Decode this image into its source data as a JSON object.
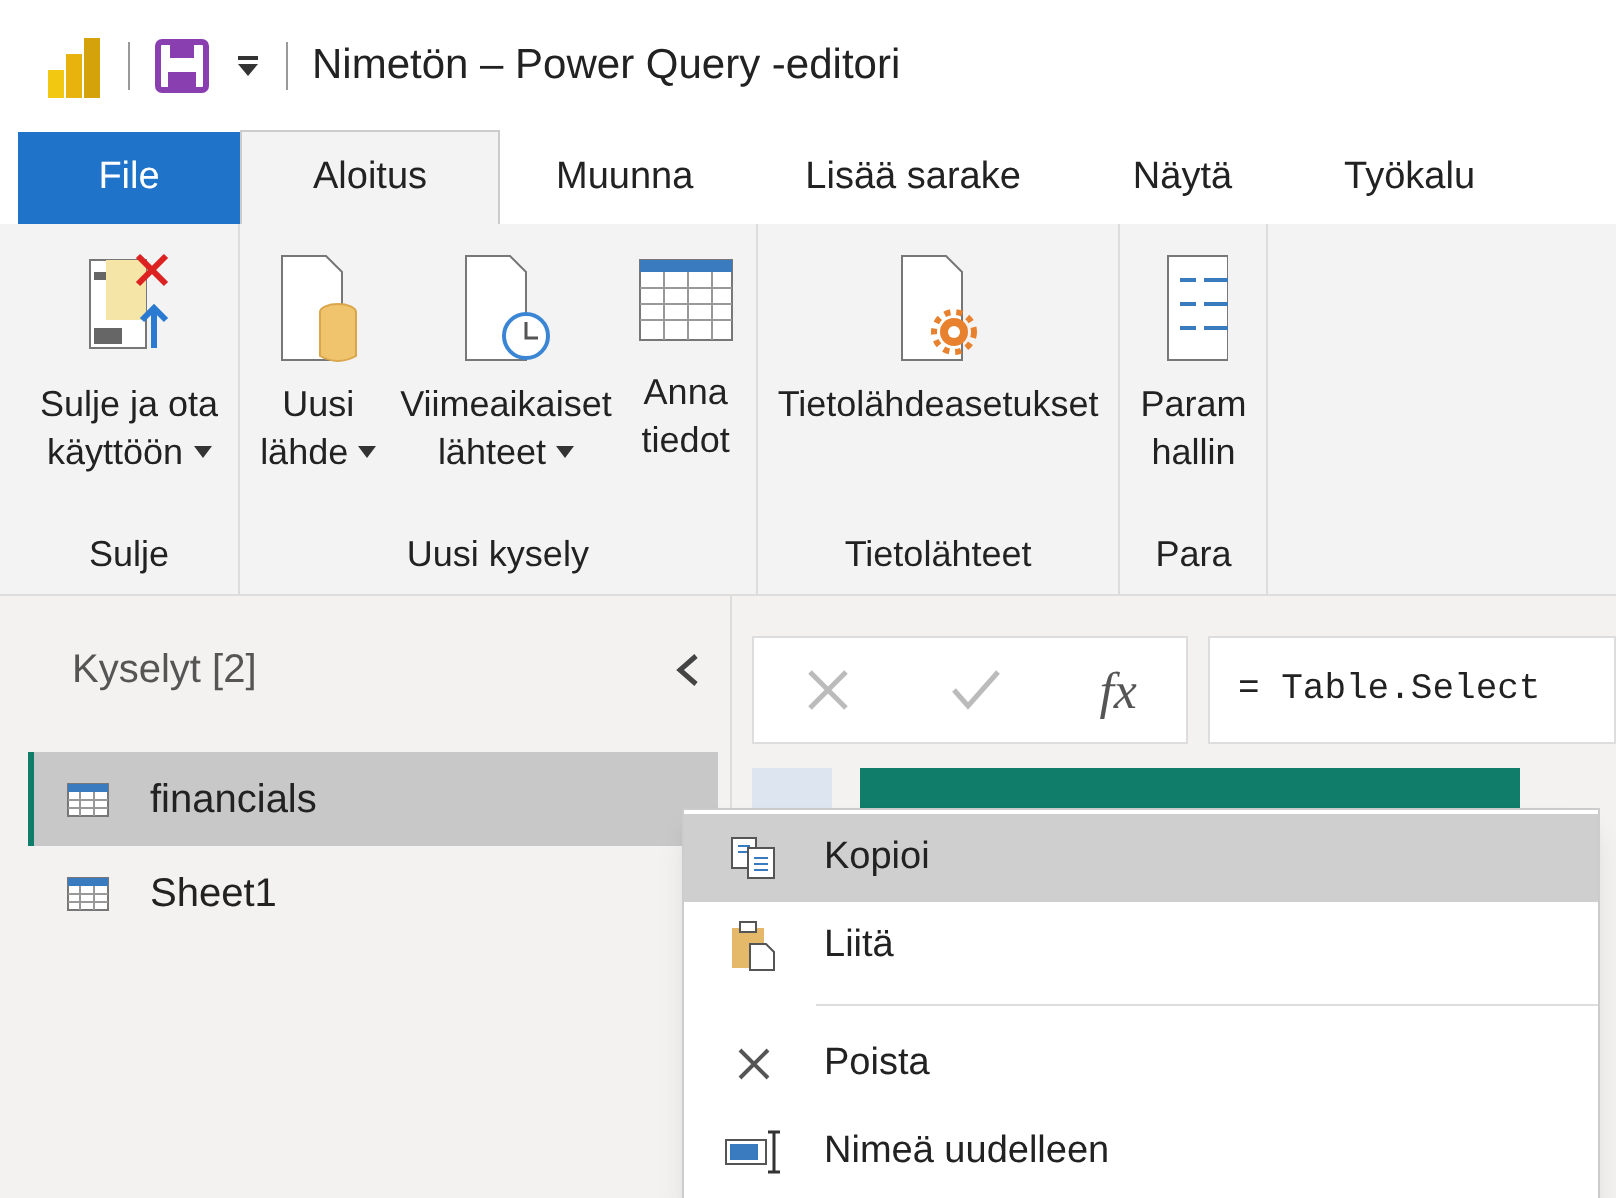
{
  "title_bar": {
    "title": "Nimetön – Power Query -editori"
  },
  "tabs": [
    {
      "label": "File",
      "kind": "file",
      "selected": false
    },
    {
      "label": "Aloitus",
      "kind": "tab",
      "selected": true
    },
    {
      "label": "Muunna",
      "kind": "tab",
      "selected": false
    },
    {
      "label": "Lisää sarake",
      "kind": "tab",
      "selected": false
    },
    {
      "label": "Näytä",
      "kind": "tab",
      "selected": false
    },
    {
      "label": "Työkalu",
      "kind": "tab",
      "selected": false
    }
  ],
  "ribbon": {
    "groups": [
      {
        "label": "Sulje",
        "buttons": [
          {
            "lines": [
              "Sulje ja ota",
              "käyttöön"
            ],
            "dropdown": true
          }
        ]
      },
      {
        "label": "Uusi kysely",
        "buttons": [
          {
            "lines": [
              "Uusi",
              "lähde"
            ],
            "dropdown": true
          },
          {
            "lines": [
              "Viimeaikaiset",
              "lähteet"
            ],
            "dropdown": true
          },
          {
            "lines": [
              "Anna",
              "tiedot"
            ],
            "dropdown": false
          }
        ]
      },
      {
        "label": "Tietolähteet",
        "buttons": [
          {
            "lines": [
              "Tietolähdeasetukset"
            ],
            "dropdown": false
          }
        ]
      },
      {
        "label": "Para",
        "buttons": [
          {
            "lines": [
              "Param",
              "hallin"
            ],
            "dropdown": false
          }
        ]
      }
    ]
  },
  "queries_pane": {
    "title": "Kyselyt [2]",
    "items": [
      {
        "name": "financials",
        "selected": true
      },
      {
        "name": "Sheet1",
        "selected": false
      }
    ]
  },
  "formula_bar": {
    "function_label": "fx",
    "formula": "= Table.Select"
  },
  "context_menu": {
    "items": [
      {
        "kind": "item",
        "label": "Kopioi",
        "selected": true
      },
      {
        "kind": "item",
        "label": "Liitä",
        "selected": false
      },
      {
        "kind": "separator"
      },
      {
        "kind": "item",
        "label": "Poista",
        "selected": false
      },
      {
        "kind": "item",
        "label": "Nimeä uudelleen",
        "selected": false
      }
    ]
  }
}
